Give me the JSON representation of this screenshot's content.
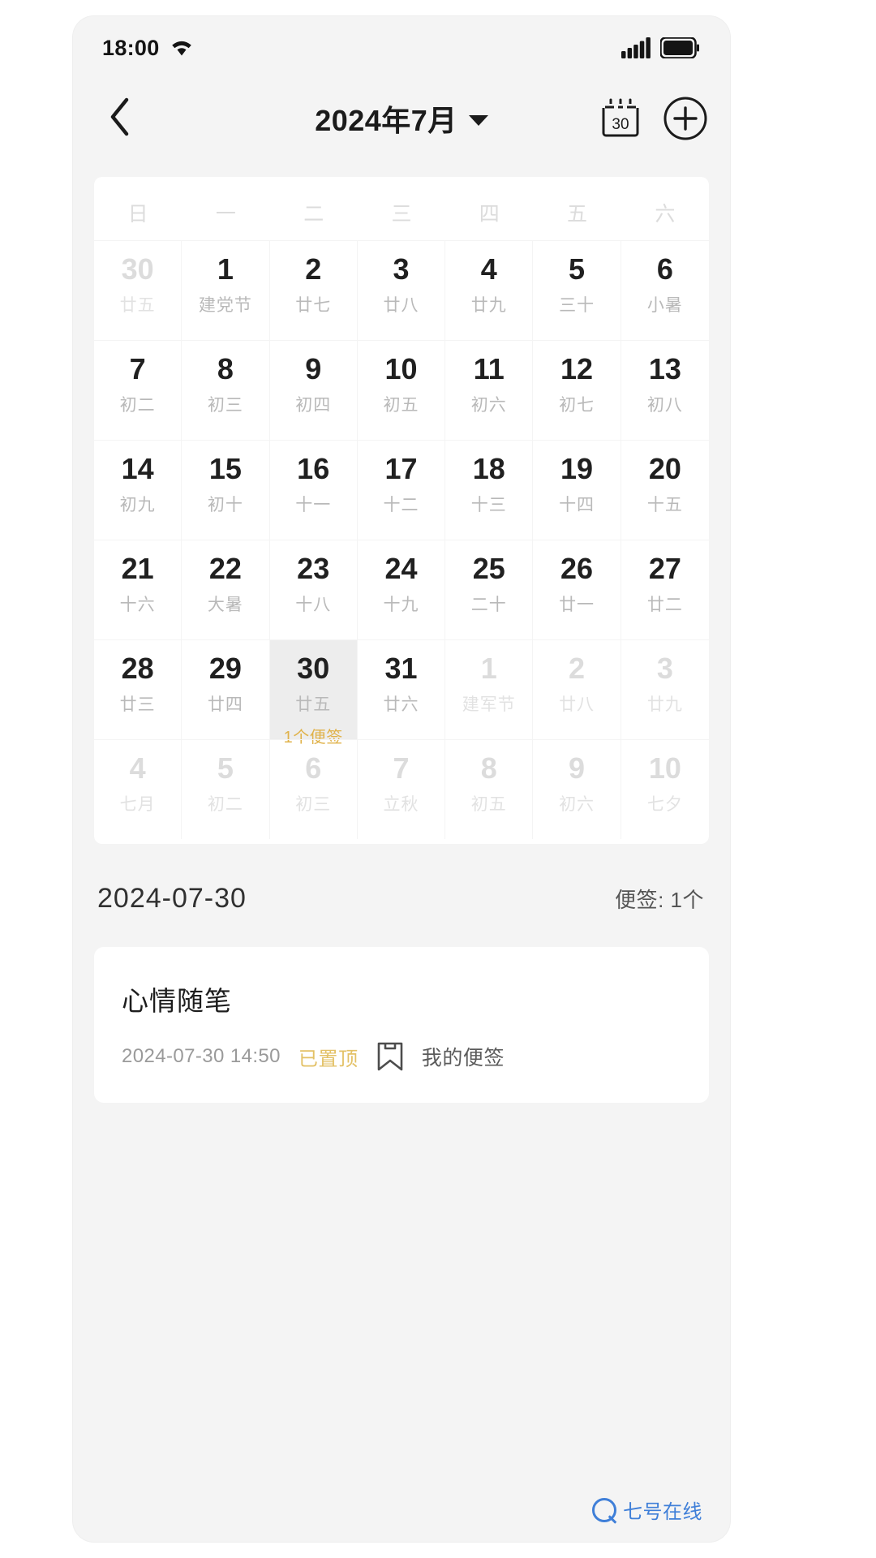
{
  "statusbar": {
    "time": "18:00",
    "wifi_icon": "wifi-icon",
    "signal_icon": "cellular-signal-icon",
    "battery_icon": "battery-full-icon"
  },
  "navbar": {
    "back_icon": "chevron-left-icon",
    "title": "2024年7月",
    "dropdown_icon": "caret-down-icon",
    "today_icon": "calendar-30-icon",
    "today_day": "30",
    "add_icon": "plus-circle-icon"
  },
  "calendar": {
    "weekdays": [
      "日",
      "一",
      "二",
      "三",
      "四",
      "五",
      "六"
    ],
    "weeks": [
      [
        {
          "day": "30",
          "lunar": "廿五",
          "out": true
        },
        {
          "day": "1",
          "lunar": "建党节"
        },
        {
          "day": "2",
          "lunar": "廿七"
        },
        {
          "day": "3",
          "lunar": "廿八"
        },
        {
          "day": "4",
          "lunar": "廿九"
        },
        {
          "day": "5",
          "lunar": "三十"
        },
        {
          "day": "6",
          "lunar": "小暑"
        }
      ],
      [
        {
          "day": "7",
          "lunar": "初二"
        },
        {
          "day": "8",
          "lunar": "初三"
        },
        {
          "day": "9",
          "lunar": "初四"
        },
        {
          "day": "10",
          "lunar": "初五"
        },
        {
          "day": "11",
          "lunar": "初六"
        },
        {
          "day": "12",
          "lunar": "初七"
        },
        {
          "day": "13",
          "lunar": "初八"
        }
      ],
      [
        {
          "day": "14",
          "lunar": "初九"
        },
        {
          "day": "15",
          "lunar": "初十"
        },
        {
          "day": "16",
          "lunar": "十一"
        },
        {
          "day": "17",
          "lunar": "十二"
        },
        {
          "day": "18",
          "lunar": "十三"
        },
        {
          "day": "19",
          "lunar": "十四"
        },
        {
          "day": "20",
          "lunar": "十五"
        }
      ],
      [
        {
          "day": "21",
          "lunar": "十六"
        },
        {
          "day": "22",
          "lunar": "大暑"
        },
        {
          "day": "23",
          "lunar": "十八"
        },
        {
          "day": "24",
          "lunar": "十九"
        },
        {
          "day": "25",
          "lunar": "二十"
        },
        {
          "day": "26",
          "lunar": "廿一"
        },
        {
          "day": "27",
          "lunar": "廿二"
        }
      ],
      [
        {
          "day": "28",
          "lunar": "廿三"
        },
        {
          "day": "29",
          "lunar": "廿四"
        },
        {
          "day": "30",
          "lunar": "廿五",
          "selected": true,
          "badge": "1个便签"
        },
        {
          "day": "31",
          "lunar": "廿六"
        },
        {
          "day": "1",
          "lunar": "建军节",
          "out": true
        },
        {
          "day": "2",
          "lunar": "廿八",
          "out": true
        },
        {
          "day": "3",
          "lunar": "廿九",
          "out": true
        }
      ],
      [
        {
          "day": "4",
          "lunar": "七月",
          "out": true
        },
        {
          "day": "5",
          "lunar": "初二",
          "out": true
        },
        {
          "day": "6",
          "lunar": "初三",
          "out": true
        },
        {
          "day": "7",
          "lunar": "立秋",
          "out": true
        },
        {
          "day": "8",
          "lunar": "初五",
          "out": true
        },
        {
          "day": "9",
          "lunar": "初六",
          "out": true
        },
        {
          "day": "10",
          "lunar": "七夕",
          "out": true
        }
      ]
    ]
  },
  "summary": {
    "date": "2024-07-30",
    "count": "便签: 1个"
  },
  "note": {
    "title": "心情随笔",
    "time": "2024-07-30 14:50",
    "pinned": "已置顶",
    "folder_icon": "bookmark-icon",
    "folder": "我的便签"
  },
  "watermark": {
    "logo_icon": "search-circle-icon",
    "text": "七号在线"
  },
  "colors": {
    "accent": "#e0b24a",
    "page_bg": "#f4f4f4",
    "card_bg": "#ffffff",
    "selected_bg": "#ededed",
    "watermark": "#3f7fd8"
  }
}
